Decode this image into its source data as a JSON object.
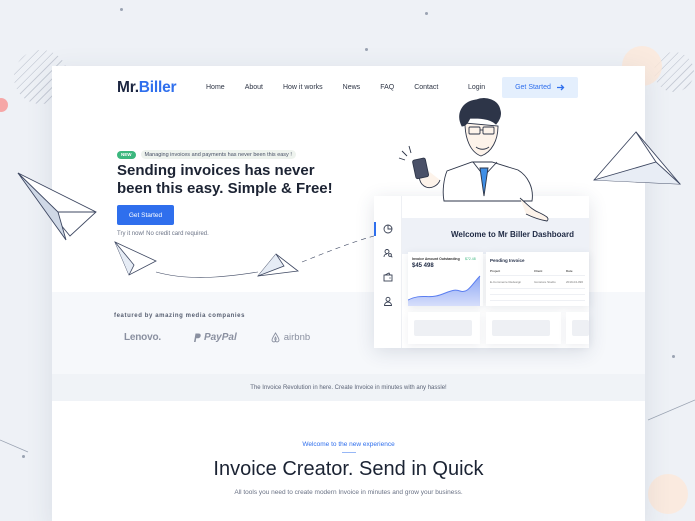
{
  "brand": {
    "logo_left": "Mr.",
    "logo_right": "Biller",
    "accent": "#2f6fed"
  },
  "nav": {
    "items": [
      {
        "label": "Home",
        "name": "nav-home"
      },
      {
        "label": "About",
        "name": "nav-about"
      },
      {
        "label": "How it works",
        "name": "nav-how-it-works"
      },
      {
        "label": "News",
        "name": "nav-news"
      },
      {
        "label": "FAQ",
        "name": "nav-faq"
      },
      {
        "label": "Contact",
        "name": "nav-contact"
      }
    ],
    "login": "Login",
    "cta": "Get Started",
    "cta_icon": "arrow-right-icon"
  },
  "hero": {
    "badge": "NEW",
    "badge_text": "Managing invoices and payments has never been this easy !",
    "title": "Sending invoices has never been this easy. Simple & Free!",
    "button": "Get Started",
    "note": "Try it now! No credit card required."
  },
  "dashboard": {
    "title": "Welcome to Mr Biller Dashboard",
    "chart_card": {
      "label": "Invoice Amount Outstanding",
      "tag": "$72.48",
      "value": "$45 498"
    },
    "pending": {
      "title": "Pending Invoice",
      "headers": [
        "Project",
        "Client",
        "Date"
      ],
      "row": [
        "E-Commerce Redesign",
        "Iconstore Studio",
        "2019-04-096"
      ]
    },
    "sidebar_icons": [
      "pie-chart-icon",
      "user-search-icon",
      "wallet-icon",
      "user-icon"
    ]
  },
  "featured": {
    "label": "featured by amazing media companies",
    "logos": [
      "Lenovo.",
      "PayPal",
      "airbnb"
    ]
  },
  "revolution": {
    "text": "The Invoice Revolution in here. Create Invoice in minutes with any hassle!"
  },
  "section": {
    "kicker": "Welcome to the new experience",
    "title": "Invoice Creator. Send in Quick",
    "subtitle": "All tools you need to create modern Invoice in minutes and grow your business."
  },
  "colors": {
    "primary": "#2f6fed",
    "badge_green": "#3bb77e",
    "text_dark": "#1c2333"
  }
}
